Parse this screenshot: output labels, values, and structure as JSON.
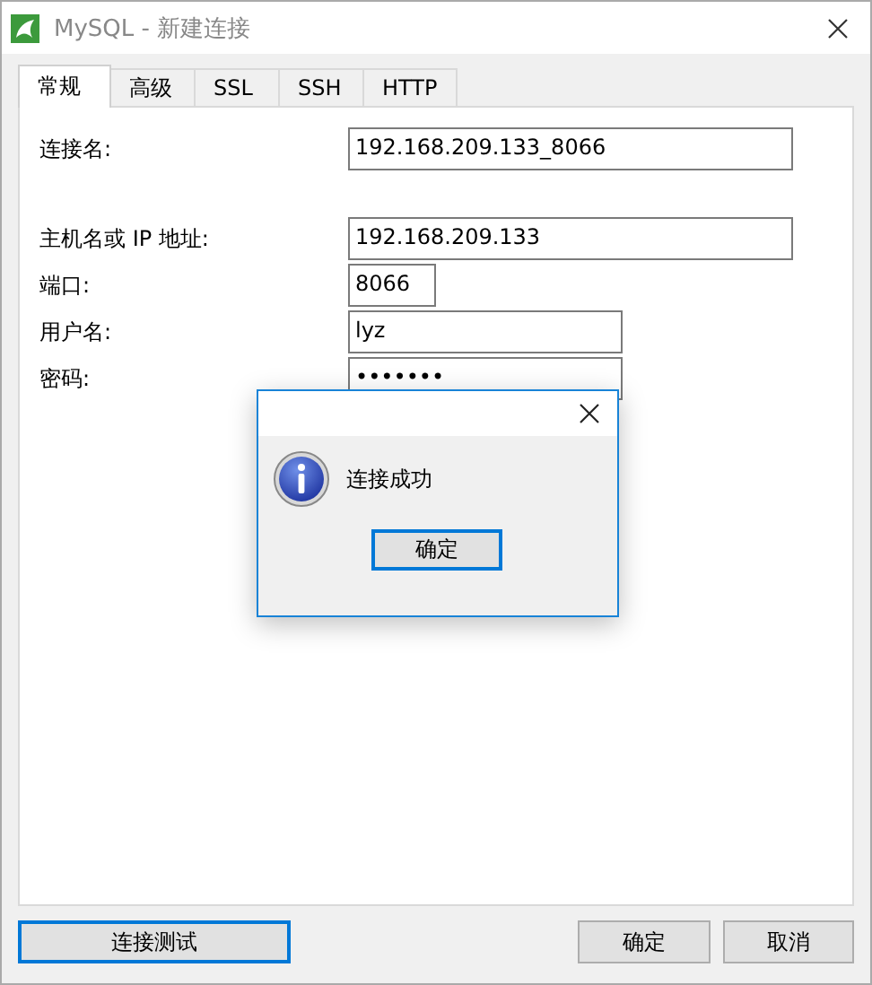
{
  "window": {
    "title": "MySQL - 新建连接"
  },
  "tabs": [
    {
      "label": "常规",
      "selected": true
    },
    {
      "label": "高级",
      "selected": false
    },
    {
      "label": "SSL",
      "selected": false
    },
    {
      "label": "SSH",
      "selected": false
    },
    {
      "label": "HTTP",
      "selected": false
    }
  ],
  "fields": [
    {
      "label": "连接名:",
      "value": "192.168.209.133_8066"
    },
    {
      "label": "主机名或 IP 地址:",
      "value": "192.168.209.133"
    },
    {
      "label": "端口:",
      "value": "8066"
    },
    {
      "label": "用户名:",
      "value": "lyz"
    },
    {
      "label": "密码:",
      "value": "•••••••"
    }
  ],
  "buttons": [
    {
      "label": "连接测试",
      "default": true
    },
    {
      "label": "确定",
      "default": false
    },
    {
      "label": "取消",
      "default": false
    }
  ],
  "message_box": {
    "message": "连接成功",
    "button": "确定"
  }
}
